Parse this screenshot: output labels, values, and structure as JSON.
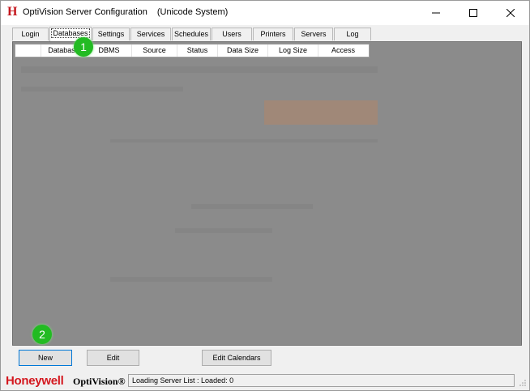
{
  "window": {
    "app_icon": "H",
    "title": "OptiVision Server Configuration",
    "title_suffix": "(Unicode System)",
    "controls": [
      "minimize-icon",
      "maximize-icon",
      "close-icon"
    ]
  },
  "tabs": [
    {
      "label": "Login"
    },
    {
      "label": "Databases",
      "active": true
    },
    {
      "label": "Settings"
    },
    {
      "label": "Services"
    },
    {
      "label": "Schedules"
    },
    {
      "label": "Users"
    },
    {
      "label": "Printers"
    },
    {
      "label": "Servers"
    },
    {
      "label": "Log"
    }
  ],
  "grid": {
    "columns": [
      "",
      "Database",
      "DBMS",
      "Source",
      "Status",
      "Data Size",
      "Log Size",
      "Access"
    ]
  },
  "annotations": {
    "marker_1": "1",
    "marker_2": "2"
  },
  "buttons": {
    "new": "New",
    "edit": "Edit",
    "edit_calendars": "Edit Calendars"
  },
  "statusbar": {
    "brand": "Honeywell",
    "product": "OptiVision®",
    "message": "Loading Server List : Loaded: 0"
  },
  "colors": {
    "brand_red": "#d4181f",
    "overlay_gray": "#8b8b8b",
    "badge_green": "#22bb22",
    "focus_blue": "#0078d7"
  }
}
